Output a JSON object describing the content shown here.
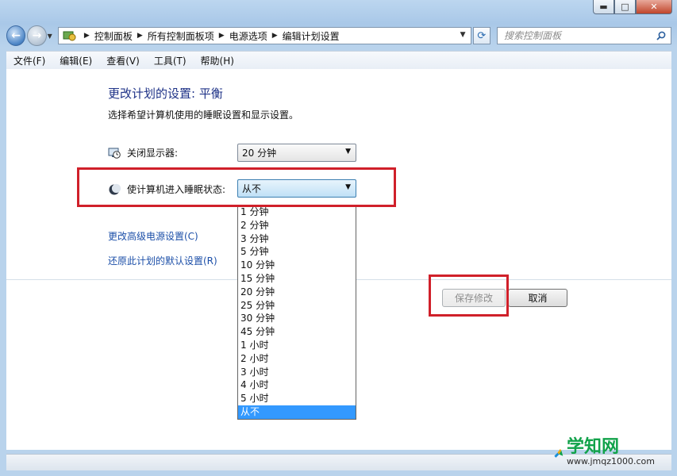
{
  "window": {
    "controls": {
      "minimize": "▬",
      "maximize": "□",
      "close": "✕"
    }
  },
  "address": {
    "crumbs": [
      "控制面板",
      "所有控制面板项",
      "电源选项",
      "编辑计划设置"
    ],
    "search_placeholder": "搜索控制面板"
  },
  "menu": [
    "文件(F)",
    "编辑(E)",
    "查看(V)",
    "工具(T)",
    "帮助(H)"
  ],
  "page": {
    "title": "更改计划的设置: 平衡",
    "subtitle": "选择希望计算机使用的睡眠设置和显示设置。"
  },
  "settings": {
    "display_off": {
      "label": "关闭显示器:",
      "value": "20 分钟",
      "icon": "monitor-clock-icon"
    },
    "sleep": {
      "label": "使计算机进入睡眠状态:",
      "value": "从不",
      "icon": "moon-icon"
    }
  },
  "sleep_options": [
    "1 分钟",
    "2 分钟",
    "3 分钟",
    "5 分钟",
    "10 分钟",
    "15 分钟",
    "20 分钟",
    "25 分钟",
    "30 分钟",
    "45 分钟",
    "1 小时",
    "2 小时",
    "3 小时",
    "4 小时",
    "5 小时",
    "从不"
  ],
  "sleep_selected": "从不",
  "links": {
    "advanced": "更改高级电源设置(C)",
    "restore": "还原此计划的默认设置(R)"
  },
  "buttons": {
    "save": "保存修改",
    "cancel": "取消"
  },
  "watermark": {
    "title": "学知网",
    "url": "www.jmqz1000.com"
  },
  "colors": {
    "highlight": "#d0202a",
    "selection": "#3399ff",
    "link": "#1c4fa8",
    "heading": "#1e3287"
  }
}
